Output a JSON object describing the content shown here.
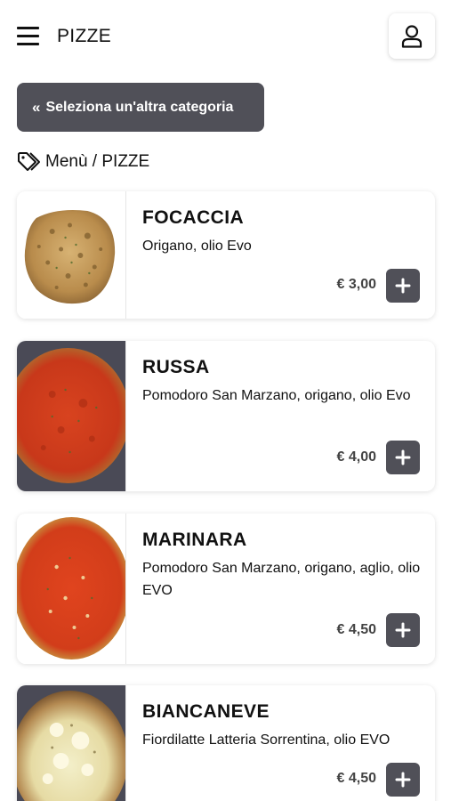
{
  "header": {
    "title": "PIZZE",
    "menu_icon": "hamburger-menu-icon",
    "user_icon": "user-icon"
  },
  "category_button": {
    "label": "Seleziona un'altra categoria",
    "icon": "double-chevron-left-icon"
  },
  "breadcrumb": {
    "text": "Menù / PIZZE",
    "icon": "tag-icon"
  },
  "products": [
    {
      "name": "FOCACCIA",
      "description": "Origano, olio Evo",
      "price": "€ 3,00"
    },
    {
      "name": "RUSSA",
      "description": "Pomodoro San Marzano, origano, olio Evo",
      "price": "€ 4,00"
    },
    {
      "name": "MARINARA",
      "description": "Pomodoro San Marzano, origano, aglio, olio EVO",
      "price": "€ 4,50"
    },
    {
      "name": "BIANCANEVE",
      "description": "Fiordilatte Latteria Sorrentina, olio EVO",
      "price": "€ 4,50"
    }
  ],
  "colors": {
    "accent": "#505058",
    "text": "#111111",
    "price": "#444444"
  }
}
